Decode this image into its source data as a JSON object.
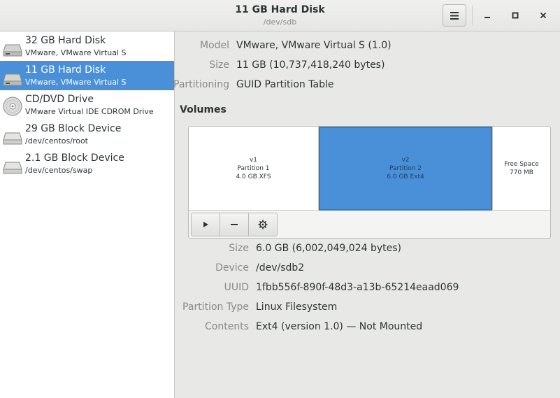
{
  "header": {
    "title": "11 GB Hard Disk",
    "subtitle": "/dev/sdb",
    "menu_icon": "hamburger-menu-icon"
  },
  "sidebar": {
    "items": [
      {
        "name": "32 GB Hard Disk",
        "sub": "VMware, VMware Virtual S",
        "icon": "hard-disk-icon",
        "selected": false
      },
      {
        "name": "11 GB Hard Disk",
        "sub": "VMware, VMware Virtual S",
        "icon": "hard-disk-icon",
        "selected": true
      },
      {
        "name": "CD/DVD Drive",
        "sub": "VMware Virtual IDE CDROM Drive",
        "icon": "optical-disc-icon",
        "selected": false
      },
      {
        "name": "29 GB Block Device",
        "sub": "/dev/centos/root",
        "icon": "block-device-icon",
        "selected": false
      },
      {
        "name": "2.1 GB Block Device",
        "sub": "/dev/centos/swap",
        "icon": "block-device-icon",
        "selected": false
      }
    ]
  },
  "disk": {
    "model_label": "Model",
    "model": "VMware, VMware Virtual S (1.0)",
    "size_label": "Size",
    "size": "11 GB (10,737,418,240 bytes)",
    "partitioning_label": "Partitioning",
    "partitioning": "GUID Partition Table"
  },
  "volumes": {
    "title": "Volumes",
    "partitions": [
      {
        "line1": "v1",
        "line2": "Partition 1",
        "line3": "4.0 GB XFS",
        "selected": false
      },
      {
        "line1": "v2",
        "line2": "Partition 2",
        "line3": "6.0 GB Ext4",
        "selected": true
      },
      {
        "line1": "Free Space",
        "line2": "770 MB",
        "line3": "",
        "selected": false
      }
    ],
    "toolbar": [
      "play-icon",
      "minus-icon",
      "gear-icon"
    ]
  },
  "partition": {
    "size_label": "Size",
    "size": "6.0 GB (6,002,049,024 bytes)",
    "device_label": "Device",
    "device": "/dev/sdb2",
    "uuid_label": "UUID",
    "uuid": "1fbb556f-890f-48d3-a13b-65214eaad069",
    "type_label": "Partition Type",
    "type": "Linux Filesystem",
    "contents_label": "Contents",
    "contents": "Ext4 (version 1.0) — Not Mounted"
  },
  "colors": {
    "accent": "#4a90d9"
  }
}
